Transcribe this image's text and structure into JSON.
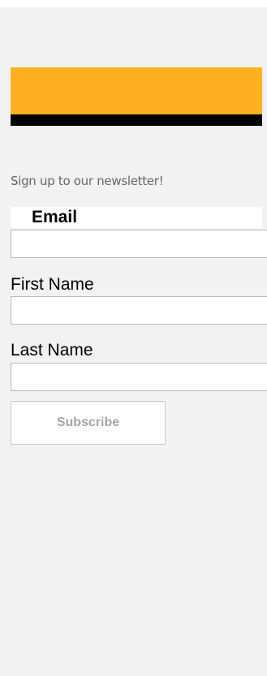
{
  "newsletter": {
    "intro": "Sign up to our newsletter!",
    "fields": {
      "email_label": "Email",
      "email_value": "",
      "first_name_label": "First Name",
      "first_name_value": "",
      "last_name_label": "Last Name",
      "last_name_value": ""
    },
    "subscribe_label": "Subscribe"
  },
  "colors": {
    "page_background": "#f2f2f2",
    "banner_accent": "#ffb020",
    "banner_bottom": "#000000",
    "button_text": "#a5a5a5"
  }
}
